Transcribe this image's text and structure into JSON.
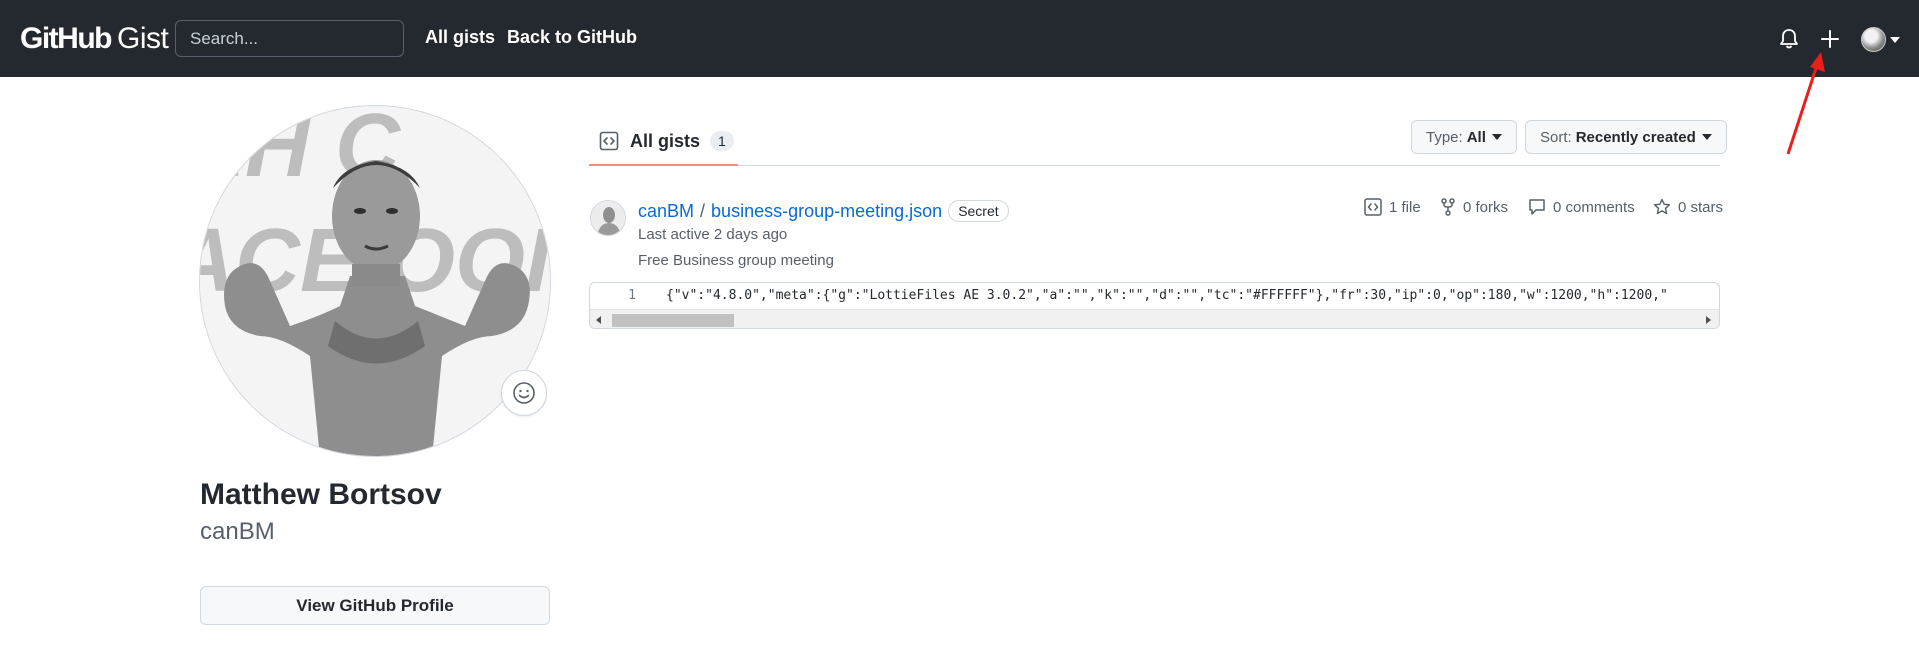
{
  "header": {
    "logo_github": "GitHub",
    "logo_gist": "Gist",
    "search_placeholder": "Search...",
    "nav": [
      "All gists",
      "Back to GitHub"
    ],
    "icons": [
      "bell-icon",
      "plus-icon",
      "avatar",
      "chevron-down-icon"
    ]
  },
  "profile": {
    "name": "Matthew Bortsov",
    "login": "canBM",
    "view_profile_label": "View GitHub Profile",
    "status_icon": "smiley-icon",
    "photo_text_fragments": [
      "AH C",
      "ACE OOI"
    ]
  },
  "tabs": {
    "all_gists_label": "All gists",
    "all_gists_count": "1",
    "type_label": "Type:",
    "type_value": "All",
    "sort_label": "Sort:",
    "sort_value": "Recently created"
  },
  "gist": {
    "owner": "canBM",
    "separator": "/",
    "filename": "business-group-meeting.json",
    "visibility": "Secret",
    "last_active": "Last active 2 days ago",
    "description": "Free Business group meeting",
    "stats": {
      "files": "1 file",
      "forks": "0 forks",
      "comments": "0 comments",
      "stars": "0 stars"
    },
    "code": {
      "line_number": "1",
      "content": "{\"v\":\"4.8.0\",\"meta\":{\"g\":\"LottieFiles AE 3.0.2\",\"a\":\"\",\"k\":\"\",\"d\":\"\",\"tc\":\"#FFFFFF\"},\"fr\":30,\"ip\":0,\"op\":180,\"w\":1200,\"h\":1200,\""
    }
  },
  "colors": {
    "header_bg": "#24292f",
    "link": "#0969da",
    "tab_underline": "#fd8c73",
    "annotation_arrow": "#e8201c"
  }
}
